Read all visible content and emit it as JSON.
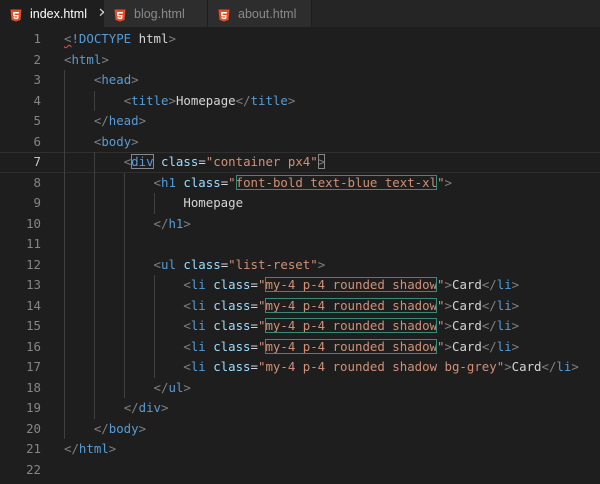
{
  "tabs": [
    {
      "label": "index.html",
      "active": true,
      "close": "✕"
    },
    {
      "label": "blog.html",
      "active": false
    },
    {
      "label": "about.html",
      "active": false
    }
  ],
  "colors": {
    "html_icon": "#e44d26",
    "tag": "#569cd6",
    "attr": "#9cdcfe",
    "string": "#ce9178",
    "punctuation": "#808080",
    "highlight_box": "#3b8a76"
  },
  "editor": {
    "current_line": 7,
    "lines": [
      {
        "n": "1",
        "tokens": [
          [
            "punc",
            "<"
          ],
          [
            "doc",
            "!DOCTYPE"
          ],
          [
            "text",
            " "
          ],
          [
            "docname",
            "html"
          ],
          [
            "punc",
            ">"
          ]
        ]
      },
      {
        "n": "2",
        "tokens": [
          [
            "punc",
            "<"
          ],
          [
            "tag",
            "html"
          ],
          [
            "punc",
            ">"
          ]
        ]
      },
      {
        "n": "3",
        "tokens": [
          [
            "text",
            "    "
          ],
          [
            "punc",
            "<"
          ],
          [
            "tag",
            "head"
          ],
          [
            "punc",
            ">"
          ]
        ]
      },
      {
        "n": "4",
        "tokens": [
          [
            "text",
            "        "
          ],
          [
            "punc",
            "<"
          ],
          [
            "tag",
            "title"
          ],
          [
            "punc",
            ">"
          ],
          [
            "text",
            "Homepage"
          ],
          [
            "punc",
            "</"
          ],
          [
            "tag",
            "title"
          ],
          [
            "punc",
            ">"
          ]
        ]
      },
      {
        "n": "5",
        "tokens": [
          [
            "text",
            "    "
          ],
          [
            "punc",
            "</"
          ],
          [
            "tag",
            "head"
          ],
          [
            "punc",
            ">"
          ]
        ]
      },
      {
        "n": "6",
        "tokens": [
          [
            "text",
            "    "
          ],
          [
            "punc",
            "<"
          ],
          [
            "tag",
            "body"
          ],
          [
            "punc",
            ">"
          ]
        ]
      },
      {
        "n": "7",
        "tokens": [
          [
            "text",
            "        "
          ],
          [
            "punc",
            "<"
          ],
          [
            "tag",
            "div"
          ],
          [
            "text",
            " "
          ],
          [
            "attr",
            "class"
          ],
          [
            "text",
            "="
          ],
          [
            "str",
            "\"container px4\""
          ],
          [
            "punc",
            ">"
          ]
        ]
      },
      {
        "n": "8",
        "tokens": [
          [
            "text",
            "            "
          ],
          [
            "punc",
            "<"
          ],
          [
            "tag",
            "h1"
          ],
          [
            "text",
            " "
          ],
          [
            "attr",
            "class"
          ],
          [
            "text",
            "="
          ],
          [
            "str",
            "\""
          ],
          [
            "strhl",
            "font-bold text-blue text-xl"
          ],
          [
            "str",
            "\""
          ],
          [
            "punc",
            ">"
          ]
        ]
      },
      {
        "n": "9",
        "tokens": [
          [
            "text",
            "                Homepage"
          ]
        ]
      },
      {
        "n": "10",
        "tokens": [
          [
            "text",
            "            "
          ],
          [
            "punc",
            "</"
          ],
          [
            "tag",
            "h1"
          ],
          [
            "punc",
            ">"
          ]
        ]
      },
      {
        "n": "11",
        "tokens": []
      },
      {
        "n": "12",
        "tokens": [
          [
            "text",
            "            "
          ],
          [
            "punc",
            "<"
          ],
          [
            "tag",
            "ul"
          ],
          [
            "text",
            " "
          ],
          [
            "attr",
            "class"
          ],
          [
            "text",
            "="
          ],
          [
            "str",
            "\"list-reset\""
          ],
          [
            "punc",
            ">"
          ]
        ]
      },
      {
        "n": "13",
        "tokens": [
          [
            "text",
            "                "
          ],
          [
            "punc",
            "<"
          ],
          [
            "tag",
            "li"
          ],
          [
            "text",
            " "
          ],
          [
            "attr",
            "class"
          ],
          [
            "text",
            "="
          ],
          [
            "str",
            "\""
          ],
          [
            "strhl",
            "my-4 p-4 rounded shadow"
          ],
          [
            "str",
            "\""
          ],
          [
            "punc",
            ">"
          ],
          [
            "text",
            "Card"
          ],
          [
            "punc",
            "</"
          ],
          [
            "tag",
            "li"
          ],
          [
            "punc",
            ">"
          ]
        ]
      },
      {
        "n": "14",
        "tokens": [
          [
            "text",
            "                "
          ],
          [
            "punc",
            "<"
          ],
          [
            "tag",
            "li"
          ],
          [
            "text",
            " "
          ],
          [
            "attr",
            "class"
          ],
          [
            "text",
            "="
          ],
          [
            "str",
            "\""
          ],
          [
            "strhl",
            "my-4 p-4 rounded shadow"
          ],
          [
            "str",
            "\""
          ],
          [
            "punc",
            ">"
          ],
          [
            "text",
            "Card"
          ],
          [
            "punc",
            "</"
          ],
          [
            "tag",
            "li"
          ],
          [
            "punc",
            ">"
          ]
        ]
      },
      {
        "n": "15",
        "tokens": [
          [
            "text",
            "                "
          ],
          [
            "punc",
            "<"
          ],
          [
            "tag",
            "li"
          ],
          [
            "text",
            " "
          ],
          [
            "attr",
            "class"
          ],
          [
            "text",
            "="
          ],
          [
            "str",
            "\""
          ],
          [
            "strhl",
            "my-4 p-4 rounded shadow"
          ],
          [
            "str",
            "\""
          ],
          [
            "punc",
            ">"
          ],
          [
            "text",
            "Card"
          ],
          [
            "punc",
            "</"
          ],
          [
            "tag",
            "li"
          ],
          [
            "punc",
            ">"
          ]
        ]
      },
      {
        "n": "16",
        "tokens": [
          [
            "text",
            "                "
          ],
          [
            "punc",
            "<"
          ],
          [
            "tag",
            "li"
          ],
          [
            "text",
            " "
          ],
          [
            "attr",
            "class"
          ],
          [
            "text",
            "="
          ],
          [
            "str",
            "\""
          ],
          [
            "strhl",
            "my-4 p-4 rounded shadow"
          ],
          [
            "str",
            "\""
          ],
          [
            "punc",
            ">"
          ],
          [
            "text",
            "Card"
          ],
          [
            "punc",
            "</"
          ],
          [
            "tag",
            "li"
          ],
          [
            "punc",
            ">"
          ]
        ]
      },
      {
        "n": "17",
        "tokens": [
          [
            "text",
            "                "
          ],
          [
            "punc",
            "<"
          ],
          [
            "tag",
            "li"
          ],
          [
            "text",
            " "
          ],
          [
            "attr",
            "class"
          ],
          [
            "text",
            "="
          ],
          [
            "str",
            "\"my-4 p-4 rounded shadow bg-grey\""
          ],
          [
            "punc",
            ">"
          ],
          [
            "text",
            "Card"
          ],
          [
            "punc",
            "</"
          ],
          [
            "tag",
            "li"
          ],
          [
            "punc",
            ">"
          ]
        ]
      },
      {
        "n": "18",
        "tokens": [
          [
            "text",
            "            "
          ],
          [
            "punc",
            "</"
          ],
          [
            "tag",
            "ul"
          ],
          [
            "punc",
            ">"
          ]
        ]
      },
      {
        "n": "19",
        "tokens": [
          [
            "text",
            "        "
          ],
          [
            "punc",
            "</"
          ],
          [
            "tag",
            "div"
          ],
          [
            "punc",
            ">"
          ]
        ]
      },
      {
        "n": "20",
        "tokens": [
          [
            "text",
            "    "
          ],
          [
            "punc",
            "</"
          ],
          [
            "tag",
            "body"
          ],
          [
            "punc",
            ">"
          ]
        ]
      },
      {
        "n": "21",
        "tokens": [
          [
            "punc",
            "</"
          ],
          [
            "tag",
            "html"
          ],
          [
            "punc",
            ">"
          ]
        ]
      },
      {
        "n": "22",
        "tokens": []
      }
    ]
  }
}
